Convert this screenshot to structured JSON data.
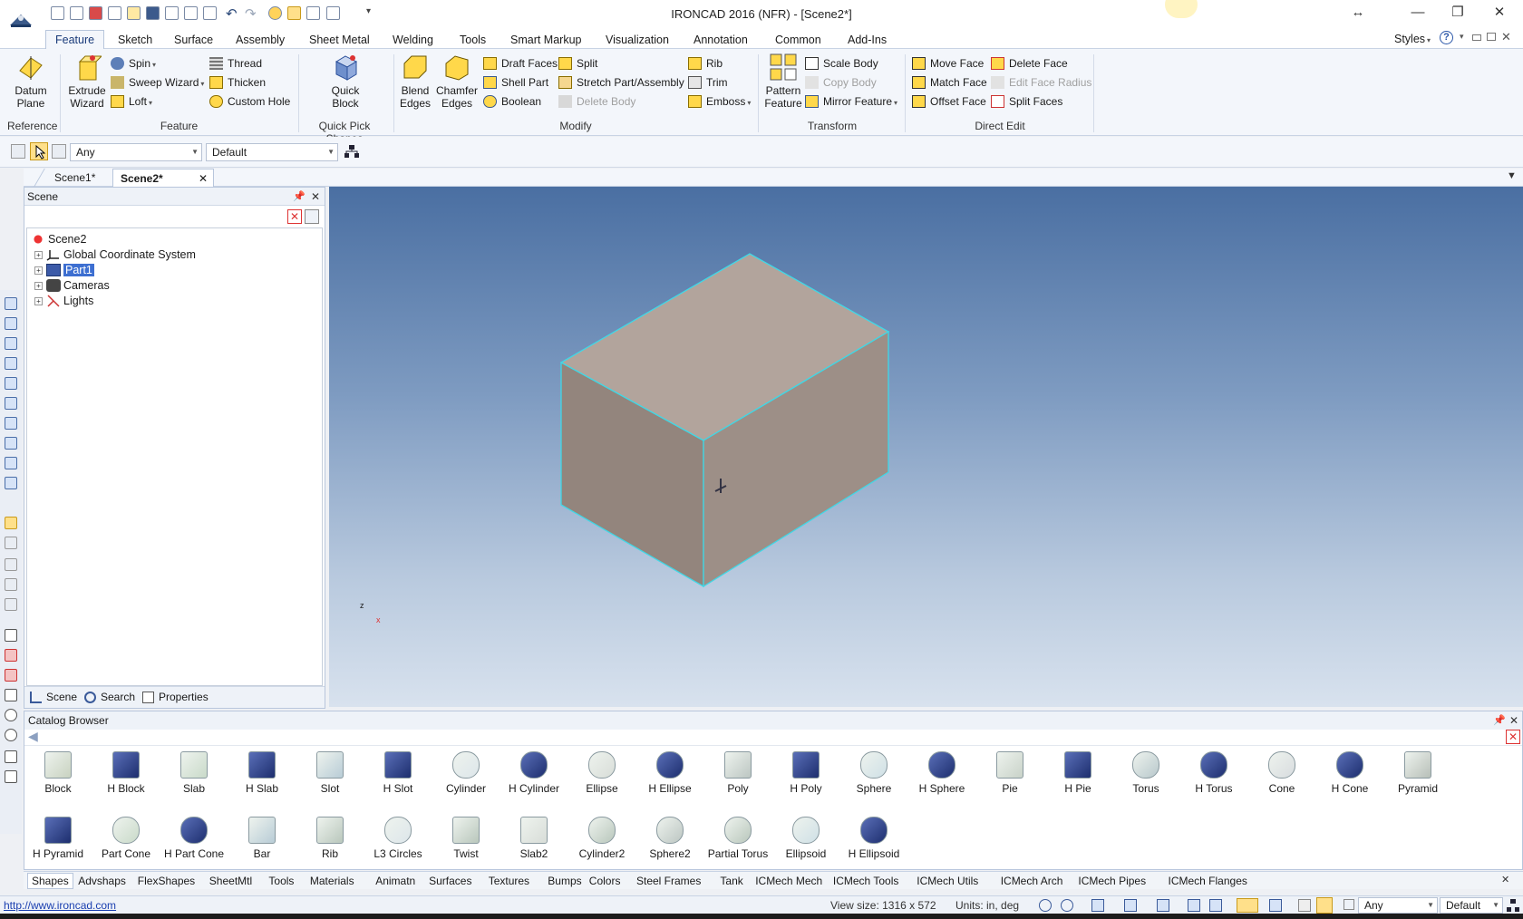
{
  "window": {
    "title": "IRONCAD 2016 (NFR) - [Scene2*]",
    "minimize": "—",
    "maximize": "❐",
    "close": "✕",
    "restore_arrow": "↔"
  },
  "ribbon": {
    "tabs": [
      "Feature",
      "Sketch",
      "Surface",
      "Assembly",
      "Sheet Metal",
      "Welding",
      "Tools",
      "Smart Markup",
      "Visualization",
      "Annotation",
      "Common",
      "Add-Ins"
    ],
    "active_tab": "Feature",
    "styles_label": "Styles",
    "groups": {
      "reference": {
        "label": "Reference",
        "datum_plane": "Datum Plane"
      },
      "feature": {
        "label": "Feature",
        "extrude_wizard": "Extrude Wizard",
        "spin": "Spin",
        "sweep_wizard": "Sweep Wizard",
        "loft": "Loft",
        "thread": "Thread",
        "thicken": "Thicken",
        "custom_hole": "Custom Hole"
      },
      "quick_pick": {
        "label": "Quick Pick Shapes",
        "quick_block": "Quick Block"
      },
      "modify": {
        "label": "Modify",
        "blend_edges": "Blend Edges",
        "chamfer_edges": "Chamfer Edges",
        "draft_faces": "Draft Faces",
        "shell_part": "Shell Part",
        "boolean": "Boolean",
        "split": "Split",
        "stretch": "Stretch Part/Assembly",
        "delete_body": "Delete Body",
        "rib": "Rib",
        "trim": "Trim",
        "emboss": "Emboss"
      },
      "transform": {
        "label": "Transform",
        "pattern_feature": "Pattern Feature",
        "scale_body": "Scale Body",
        "copy_body": "Copy Body",
        "mirror_feature": "Mirror Feature"
      },
      "direct_edit": {
        "label": "Direct Edit",
        "move_face": "Move Face",
        "match_face": "Match Face",
        "offset_face": "Offset Face",
        "delete_face": "Delete Face",
        "edit_face_radius": "Edit Face Radius",
        "split_faces": "Split Faces"
      }
    }
  },
  "selection_bar": {
    "filter": "Any",
    "style": "Default"
  },
  "doc_tabs": [
    {
      "label": "Scene1*"
    },
    {
      "label": "Scene2*"
    }
  ],
  "scene_panel": {
    "title": "Scene",
    "tree": [
      {
        "label": "Scene2"
      },
      {
        "label": "Global Coordinate System"
      },
      {
        "label": "Part1"
      },
      {
        "label": "Cameras"
      },
      {
        "label": "Lights"
      }
    ],
    "footer_tabs": [
      "Scene",
      "Search",
      "Properties"
    ]
  },
  "viewport": {
    "axis_z": "z",
    "axis_x": "x",
    "box_top": "#b2a49c",
    "box_left": "#93857d",
    "box_right": "#9d8f87",
    "edge": "#3fd8e6"
  },
  "catalog": {
    "title": "Catalog Browser",
    "items_row1": [
      "Block",
      "H Block",
      "Slab",
      "H Slab",
      "Slot",
      "H Slot",
      "Cylinder",
      "H Cylinder",
      "Ellipse",
      "H Ellipse",
      "Poly",
      "H Poly",
      "Sphere",
      "H Sphere",
      "Pie",
      "H Pie",
      "Torus",
      "H Torus",
      "Cone",
      "H Cone",
      "Pyramid"
    ],
    "items_row2": [
      "H Pyramid",
      "Part Cone",
      "H Part Cone",
      "Bar",
      "Rib",
      "L3 Circles",
      "Twist",
      "Slab2",
      "Cylinder2",
      "Sphere2",
      "Partial Torus",
      "Ellipsoid",
      "H Ellipsoid"
    ],
    "tabs": [
      "Shapes",
      "Advshaps",
      "FlexShapes",
      "SheetMtl",
      "Tools",
      "Materials",
      "Animatn",
      "Surfaces",
      "Textures",
      "Bumps",
      "Colors",
      "Steel Frames",
      "Tank",
      "ICMech Mech",
      "ICMech Tools",
      "ICMech Utils",
      "ICMech Arch",
      "ICMech  Pipes",
      "ICMech Flanges"
    ]
  },
  "status": {
    "url": "http://www.ironcad.com",
    "view_size": "View size: 1316 x  572",
    "units": "Units: in, deg",
    "filter": "Any",
    "style": "Default"
  }
}
